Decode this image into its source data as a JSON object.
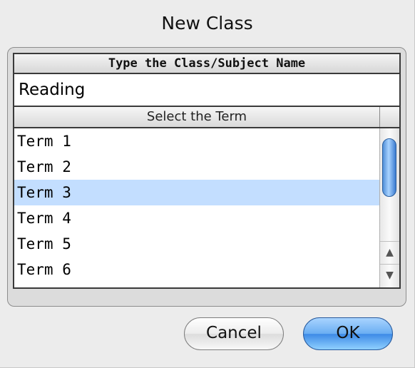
{
  "window": {
    "title": "New Class"
  },
  "name_section": {
    "header": "Type the Class/Subject Name",
    "value": "Reading"
  },
  "term_section": {
    "header": "Select the Term",
    "items": [
      "Term 1",
      "Term 2",
      "Term 3",
      "Term 4",
      "Term 5",
      "Term 6"
    ],
    "selected_index": 2
  },
  "scrollbar": {
    "up_arrow": "▲",
    "down_arrow": "▼"
  },
  "buttons": {
    "cancel": "Cancel",
    "ok": "OK"
  },
  "colors": {
    "selection": "#c3deff",
    "default_button": "#3d8ae6"
  }
}
